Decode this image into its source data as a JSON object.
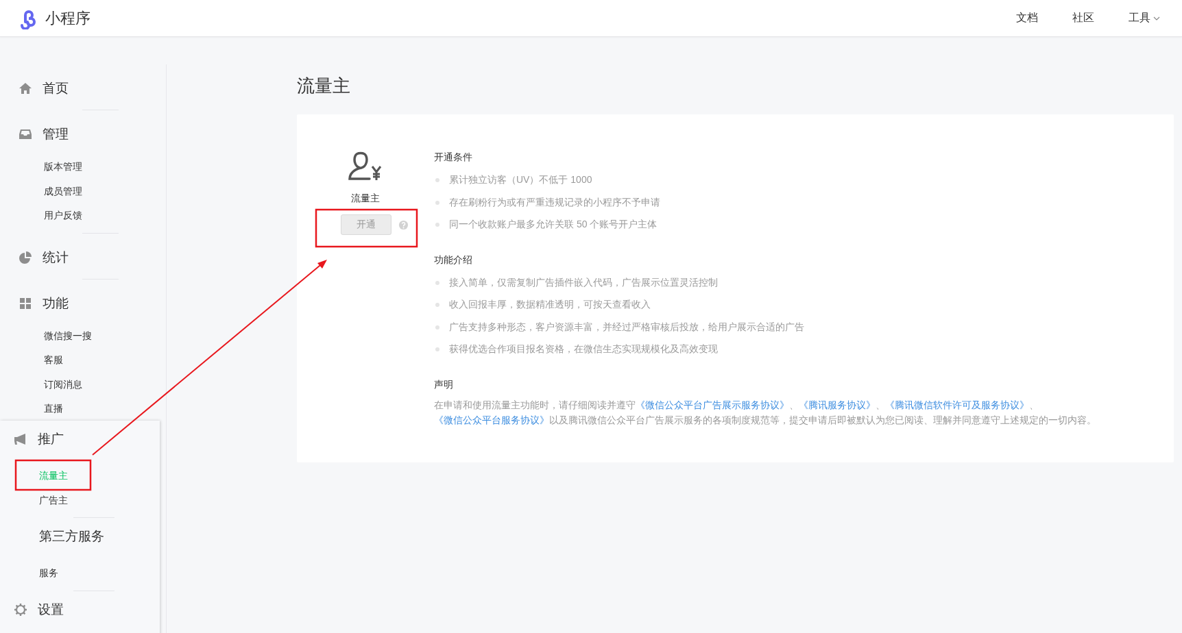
{
  "header": {
    "brand": "小程序",
    "nav": [
      {
        "label": "文档"
      },
      {
        "label": "社区"
      },
      {
        "label": "工具"
      }
    ]
  },
  "sidebar": {
    "sections": [
      {
        "title": "首页"
      },
      {
        "title": "管理",
        "items": [
          {
            "label": "版本管理",
            "selected": false
          },
          {
            "label": "成员管理",
            "selected": false
          },
          {
            "label": "用户反馈",
            "selected": false
          }
        ]
      },
      {
        "title": "统计"
      },
      {
        "title": "功能",
        "items": [
          {
            "label": "微信搜一搜",
            "selected": false
          },
          {
            "label": "客服",
            "selected": false
          },
          {
            "label": "订阅消息",
            "selected": false
          },
          {
            "label": "直播",
            "selected": false
          }
        ]
      }
    ],
    "flyout": {
      "sections": [
        {
          "title": "推广",
          "items": [
            {
              "label": "流量主",
              "selected": true
            },
            {
              "label": "广告主",
              "selected": false
            }
          ]
        },
        {
          "title": "第三方服务",
          "items": [
            {
              "label": "服务",
              "selected": false
            }
          ]
        },
        {
          "title": "设置"
        }
      ]
    }
  },
  "page": {
    "title": "流量主",
    "product": {
      "name": "流量主",
      "button": {
        "label": "开通",
        "disabled": true
      }
    },
    "sections": [
      {
        "heading": "开通条件",
        "bullets": [
          "累计独立访客（UV）不低于 1000",
          "存在刷粉行为或有严重违规记录的小程序不予申请",
          "同一个收款账户最多允许关联 50 个账号开户主体"
        ]
      },
      {
        "heading": "功能介绍",
        "bullets": [
          "接入简单，仅需复制广告插件嵌入代码，广告展示位置灵活控制",
          "收入回报丰厚，数据精准透明，可按天查看收入",
          "广告支持多种形态，客户资源丰富，并经过严格审核后投放，给用户展示合适的广告",
          "获得优选合作项目报名资格，在微信生态实现规模化及高效变现"
        ]
      }
    ],
    "statement": {
      "heading": "声明",
      "segments": [
        {
          "kind": "text",
          "text": "在申请和使用流量主功能时，请仔细阅读并遵守"
        },
        {
          "kind": "link",
          "text": "《微信公众平台广告展示服务协议》"
        },
        {
          "kind": "text",
          "text": "、"
        },
        {
          "kind": "link",
          "text": "《腾讯服务协议》"
        },
        {
          "kind": "text",
          "text": "、"
        },
        {
          "kind": "link",
          "text": "《腾讯微信软件许可及服务协议》"
        },
        {
          "kind": "text",
          "text": "、"
        },
        {
          "kind": "link",
          "text": "《微信公众平台服务协议》"
        },
        {
          "kind": "text",
          "text": "以及腾讯微信公众平台广告展示服务的各项制度规范等，提交申请后即被默认为您已阅读、理解并同意遵守上述规定的一切内容。"
        }
      ]
    }
  }
}
